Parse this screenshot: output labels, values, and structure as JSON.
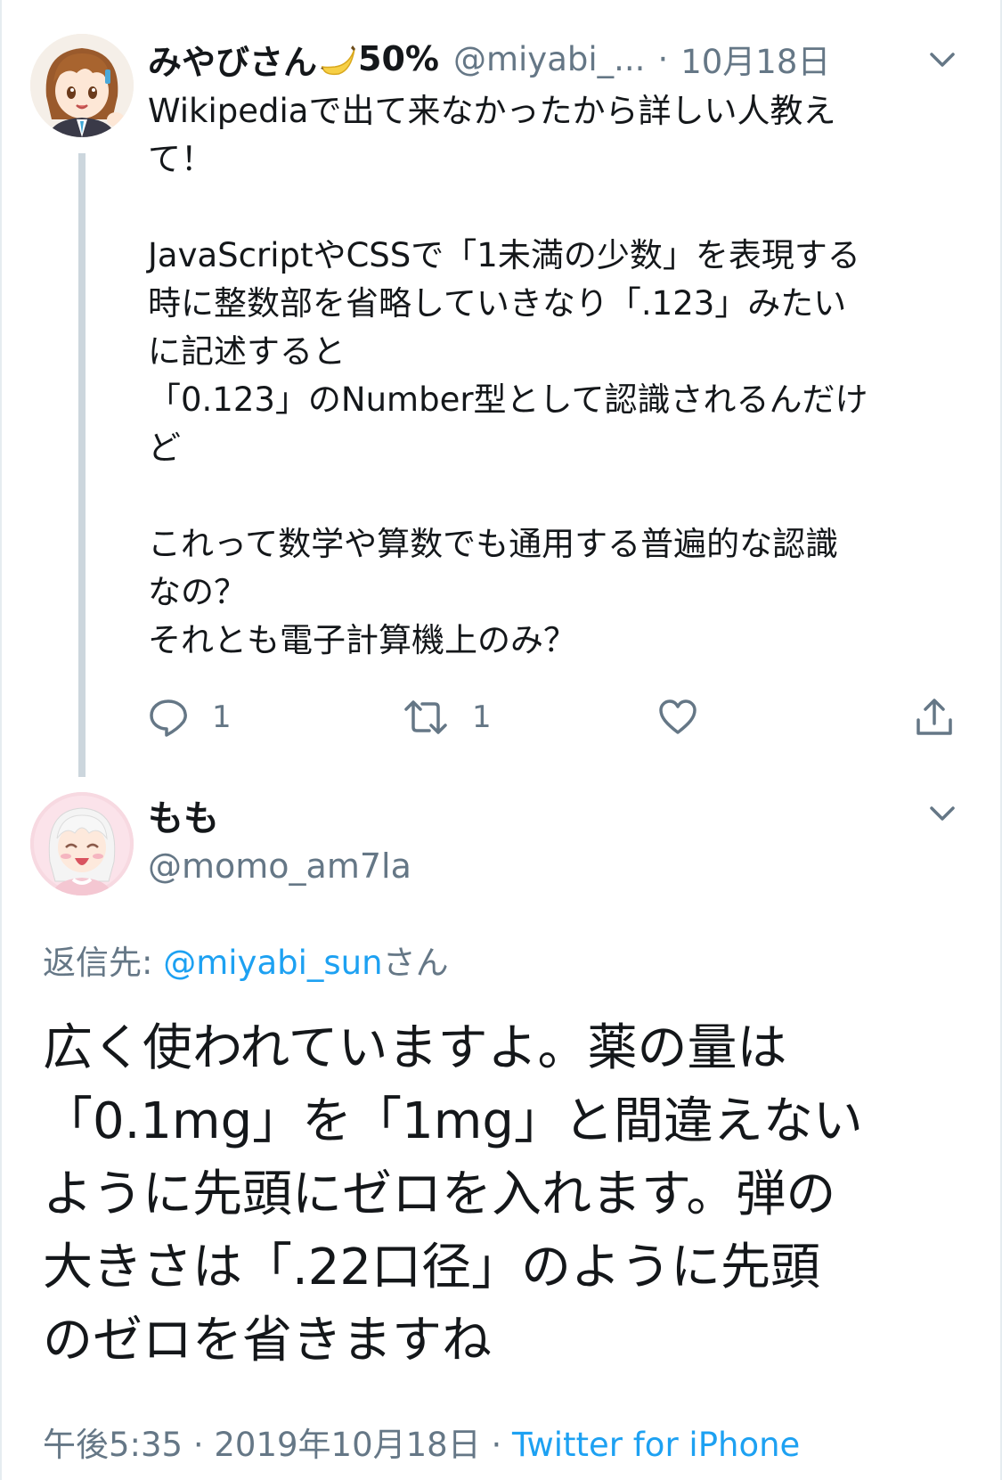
{
  "tweet1": {
    "display_name": "みやびさん",
    "name_emoji": "banana",
    "name_suffix": "50%",
    "handle": "@miyabi_...",
    "separator": "·",
    "date": "10月18日",
    "text": "Wikipediaで出て来なかったから詳しい人教え\nて！\n\nJavaScriptやCSSで「1未満の少数」を表現する\n時に整数部を省略していきなり「.123」みたい\nに記述すると\n「0.123」のNumber型として認識されるんだけ\nど\n\nこれって数学や算数でも通用する普遍的な認識\nなの？\nそれとも電子計算機上のみ？",
    "reply_count": "1",
    "retweet_count": "1",
    "icons": [
      "chevron-down-icon",
      "reply-icon",
      "retweet-icon",
      "like-icon",
      "share-icon"
    ]
  },
  "tweet2": {
    "display_name": "もも",
    "handle": "@momo_am7la",
    "reply_label": "返信先:",
    "reply_mention": "@miyabi_sun",
    "reply_suffix": "さん",
    "text": "広く使われていますよ。薬の量は\n「0.1mg」を「1mg」と間違えない\nように先頭にゼロを入れます。弾の\n大きさは「.22口径」のように先頭\nのゼロを省きますね",
    "time": "午後5:35",
    "separator": "·",
    "date": "2019年10月18日",
    "source": "Twitter for iPhone"
  },
  "colors": {
    "text": "#14171a",
    "muted": "#657786",
    "link": "#1da1f2",
    "thread_line": "#ccd6dd"
  }
}
